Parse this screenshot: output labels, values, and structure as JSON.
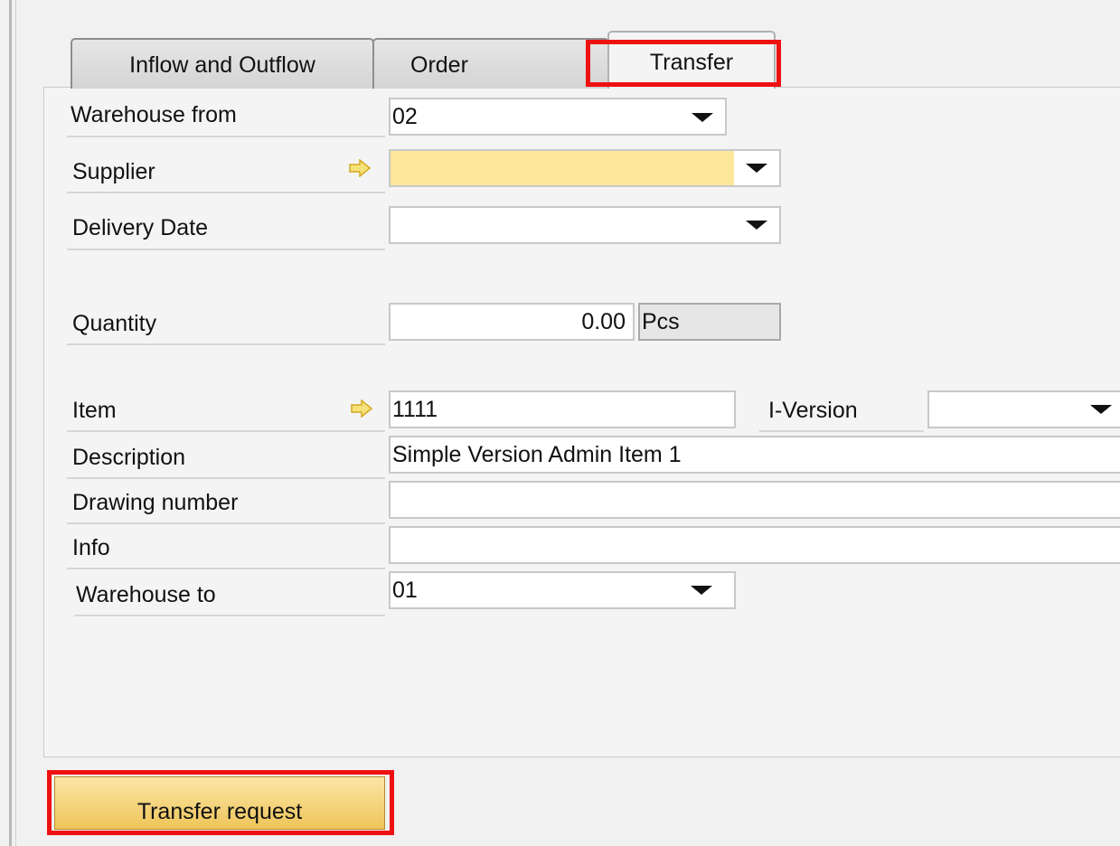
{
  "tabs": [
    {
      "label": "Inflow and Outflow"
    },
    {
      "label": "Order"
    },
    {
      "label": "Transfer"
    }
  ],
  "form": {
    "warehouse_from": {
      "label": "Warehouse from",
      "value": "02"
    },
    "supplier": {
      "label": "Supplier",
      "value": ""
    },
    "delivery_date": {
      "label": "Delivery Date",
      "value": ""
    },
    "quantity": {
      "label": "Quantity",
      "value": "0.00",
      "unit": "Pcs"
    },
    "item": {
      "label": "Item",
      "value": "1111"
    },
    "i_version": {
      "label": "I-Version",
      "value": ""
    },
    "description": {
      "label": "Description",
      "value": "Simple Version Admin Item 1"
    },
    "drawing_number": {
      "label": "Drawing number",
      "value": ""
    },
    "info": {
      "label": "Info",
      "value": ""
    },
    "warehouse_to": {
      "label": "Warehouse to",
      "value": "01"
    }
  },
  "actions": {
    "transfer_request": "Transfer request"
  },
  "colors": {
    "mandatory_field": "#fbe69a",
    "highlight": "#ee1111",
    "button": "#efc55a",
    "link_arrow": "#f2d23c"
  },
  "icons": {
    "link_arrow": "link-arrow-icon",
    "dropdown": "chevron-down-icon"
  }
}
